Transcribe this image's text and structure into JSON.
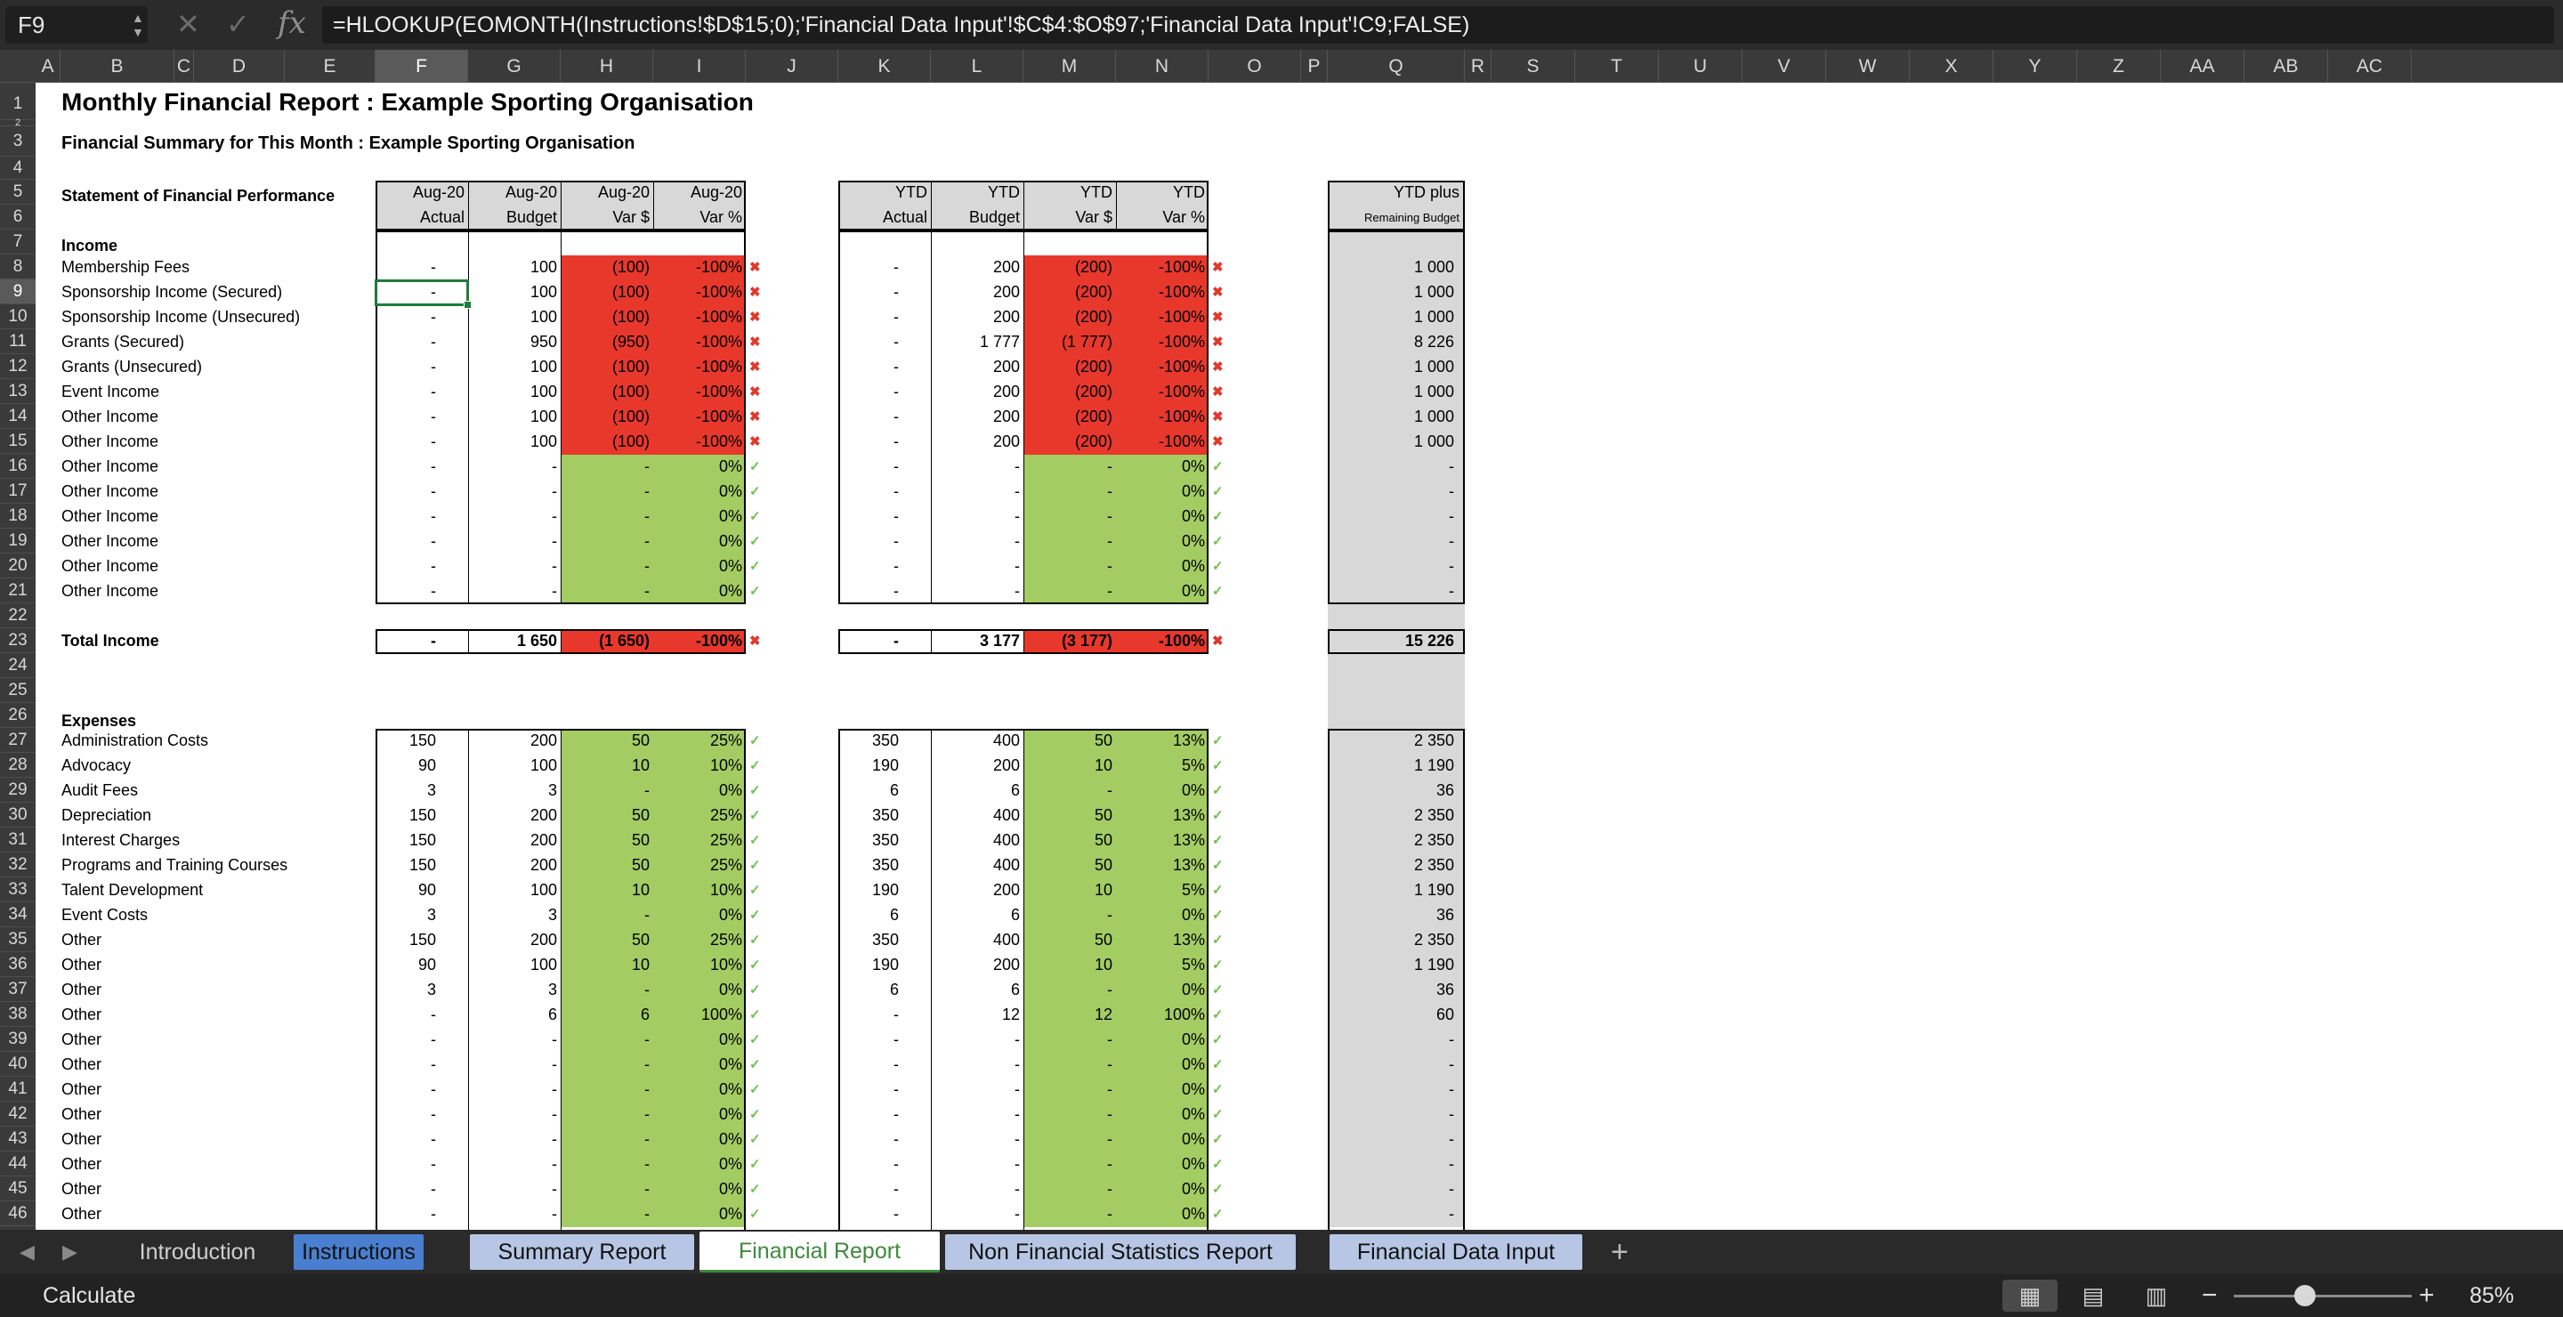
{
  "formula_bar": {
    "cell_ref": "F9",
    "cancel_icon": "✕",
    "confirm_icon": "✓",
    "fx_label": "fx",
    "formula": "=HLOOKUP(EOMONTH(Instructions!$D$15;0);'Financial Data Input'!$C$4:$O$97;'Financial Data Input'!C9;FALSE)"
  },
  "columns": [
    "A",
    "B",
    "C",
    "D",
    "E",
    "F",
    "G",
    "H",
    "I",
    "J",
    "K",
    "L",
    "M",
    "N",
    "O",
    "P",
    "Q",
    "R",
    "S",
    "T",
    "U",
    "V",
    "W",
    "X",
    "Y",
    "Z",
    "AA",
    "AB",
    "AC"
  ],
  "selected_column": "F",
  "selected_row": 9,
  "report": {
    "title": "Monthly Financial Report : Example Sporting Organisation",
    "subtitle": "Financial Summary for This Month : Example Sporting Organisation",
    "statement_label": "Statement of Financial Performance",
    "income_label": "Income",
    "expenses_label": "Expenses"
  },
  "month_headers": {
    "top": [
      "Aug-20",
      "Aug-20",
      "Aug-20",
      "Aug-20"
    ],
    "bottom": [
      "Actual",
      "Budget",
      "Var $",
      "Var %"
    ]
  },
  "ytd_headers": {
    "top": [
      "YTD",
      "YTD",
      "YTD",
      "YTD"
    ],
    "bottom": [
      "Actual",
      "Budget",
      "Var $",
      "Var %"
    ]
  },
  "remaining_header": {
    "top": "YTD plus",
    "bottom": "Remaining Budget"
  },
  "icons": {
    "cross": "✖",
    "check": "✓"
  },
  "status_colors": {
    "unfavourable": "#e8382c",
    "favourable": "#a3cc63",
    "header_fill": "#d8d8d8"
  },
  "income_rows": [
    {
      "row": 8,
      "label": "Membership Fees",
      "m": [
        "-",
        "100",
        "(100)",
        "-100%"
      ],
      "ok": false,
      "y": [
        "-",
        "200",
        "(200)",
        "-100%"
      ],
      "yok": false,
      "rem": "1 000"
    },
    {
      "row": 9,
      "label": "Sponsorship Income (Secured)",
      "m": [
        "-",
        "100",
        "(100)",
        "-100%"
      ],
      "ok": false,
      "y": [
        "-",
        "200",
        "(200)",
        "-100%"
      ],
      "yok": false,
      "rem": "1 000"
    },
    {
      "row": 10,
      "label": "Sponsorship Income (Unsecured)",
      "m": [
        "-",
        "100",
        "(100)",
        "-100%"
      ],
      "ok": false,
      "y": [
        "-",
        "200",
        "(200)",
        "-100%"
      ],
      "yok": false,
      "rem": "1 000"
    },
    {
      "row": 11,
      "label": "Grants (Secured)",
      "m": [
        "-",
        "950",
        "(950)",
        "-100%"
      ],
      "ok": false,
      "y": [
        "-",
        "1 777",
        "(1 777)",
        "-100%"
      ],
      "yok": false,
      "rem": "8 226"
    },
    {
      "row": 12,
      "label": "Grants (Unsecured)",
      "m": [
        "-",
        "100",
        "(100)",
        "-100%"
      ],
      "ok": false,
      "y": [
        "-",
        "200",
        "(200)",
        "-100%"
      ],
      "yok": false,
      "rem": "1 000"
    },
    {
      "row": 13,
      "label": "Event Income",
      "m": [
        "-",
        "100",
        "(100)",
        "-100%"
      ],
      "ok": false,
      "y": [
        "-",
        "200",
        "(200)",
        "-100%"
      ],
      "yok": false,
      "rem": "1 000"
    },
    {
      "row": 14,
      "label": "Other Income",
      "m": [
        "-",
        "100",
        "(100)",
        "-100%"
      ],
      "ok": false,
      "y": [
        "-",
        "200",
        "(200)",
        "-100%"
      ],
      "yok": false,
      "rem": "1 000"
    },
    {
      "row": 15,
      "label": "Other Income",
      "m": [
        "-",
        "100",
        "(100)",
        "-100%"
      ],
      "ok": false,
      "y": [
        "-",
        "200",
        "(200)",
        "-100%"
      ],
      "yok": false,
      "rem": "1 000"
    },
    {
      "row": 16,
      "label": "Other Income",
      "m": [
        "-",
        "-",
        "-",
        "0%"
      ],
      "ok": true,
      "y": [
        "-",
        "-",
        "-",
        "0%"
      ],
      "yok": true,
      "rem": "-"
    },
    {
      "row": 17,
      "label": "Other Income",
      "m": [
        "-",
        "-",
        "-",
        "0%"
      ],
      "ok": true,
      "y": [
        "-",
        "-",
        "-",
        "0%"
      ],
      "yok": true,
      "rem": "-"
    },
    {
      "row": 18,
      "label": "Other Income",
      "m": [
        "-",
        "-",
        "-",
        "0%"
      ],
      "ok": true,
      "y": [
        "-",
        "-",
        "-",
        "0%"
      ],
      "yok": true,
      "rem": "-"
    },
    {
      "row": 19,
      "label": "Other Income",
      "m": [
        "-",
        "-",
        "-",
        "0%"
      ],
      "ok": true,
      "y": [
        "-",
        "-",
        "-",
        "0%"
      ],
      "yok": true,
      "rem": "-"
    },
    {
      "row": 20,
      "label": "Other Income",
      "m": [
        "-",
        "-",
        "-",
        "0%"
      ],
      "ok": true,
      "y": [
        "-",
        "-",
        "-",
        "0%"
      ],
      "yok": true,
      "rem": "-"
    },
    {
      "row": 21,
      "label": "Other Income",
      "m": [
        "-",
        "-",
        "-",
        "0%"
      ],
      "ok": true,
      "y": [
        "-",
        "-",
        "-",
        "0%"
      ],
      "yok": true,
      "rem": "-"
    }
  ],
  "total_income": {
    "row": 23,
    "label": "Total Income",
    "m": [
      "-",
      "1 650",
      "(1 650)",
      "-100%"
    ],
    "ok": false,
    "y": [
      "-",
      "3 177",
      "(3 177)",
      "-100%"
    ],
    "yok": false,
    "rem": "15 226"
  },
  "expense_rows": [
    {
      "row": 27,
      "label": "Administration Costs",
      "m": [
        "150",
        "200",
        "50",
        "25%"
      ],
      "ok": true,
      "y": [
        "350",
        "400",
        "50",
        "13%"
      ],
      "yok": true,
      "rem": "2 350"
    },
    {
      "row": 28,
      "label": "Advocacy",
      "m": [
        "90",
        "100",
        "10",
        "10%"
      ],
      "ok": true,
      "y": [
        "190",
        "200",
        "10",
        "5%"
      ],
      "yok": true,
      "rem": "1 190"
    },
    {
      "row": 29,
      "label": "Audit Fees",
      "m": [
        "3",
        "3",
        "-",
        "0%"
      ],
      "ok": true,
      "y": [
        "6",
        "6",
        "-",
        "0%"
      ],
      "yok": true,
      "rem": "36"
    },
    {
      "row": 30,
      "label": "Depreciation",
      "m": [
        "150",
        "200",
        "50",
        "25%"
      ],
      "ok": true,
      "y": [
        "350",
        "400",
        "50",
        "13%"
      ],
      "yok": true,
      "rem": "2 350"
    },
    {
      "row": 31,
      "label": "Interest Charges",
      "m": [
        "150",
        "200",
        "50",
        "25%"
      ],
      "ok": true,
      "y": [
        "350",
        "400",
        "50",
        "13%"
      ],
      "yok": true,
      "rem": "2 350"
    },
    {
      "row": 32,
      "label": "Programs and Training Courses",
      "m": [
        "150",
        "200",
        "50",
        "25%"
      ],
      "ok": true,
      "y": [
        "350",
        "400",
        "50",
        "13%"
      ],
      "yok": true,
      "rem": "2 350"
    },
    {
      "row": 33,
      "label": "Talent Development",
      "m": [
        "90",
        "100",
        "10",
        "10%"
      ],
      "ok": true,
      "y": [
        "190",
        "200",
        "10",
        "5%"
      ],
      "yok": true,
      "rem": "1 190"
    },
    {
      "row": 34,
      "label": "Event Costs",
      "m": [
        "3",
        "3",
        "-",
        "0%"
      ],
      "ok": true,
      "y": [
        "6",
        "6",
        "-",
        "0%"
      ],
      "yok": true,
      "rem": "36"
    },
    {
      "row": 35,
      "label": "Other",
      "m": [
        "150",
        "200",
        "50",
        "25%"
      ],
      "ok": true,
      "y": [
        "350",
        "400",
        "50",
        "13%"
      ],
      "yok": true,
      "rem": "2 350"
    },
    {
      "row": 36,
      "label": "Other",
      "m": [
        "90",
        "100",
        "10",
        "10%"
      ],
      "ok": true,
      "y": [
        "190",
        "200",
        "10",
        "5%"
      ],
      "yok": true,
      "rem": "1 190"
    },
    {
      "row": 37,
      "label": "Other",
      "m": [
        "3",
        "3",
        "-",
        "0%"
      ],
      "ok": true,
      "y": [
        "6",
        "6",
        "-",
        "0%"
      ],
      "yok": true,
      "rem": "36"
    },
    {
      "row": 38,
      "label": "Other",
      "m": [
        "-",
        "6",
        "6",
        "100%"
      ],
      "ok": true,
      "y": [
        "-",
        "12",
        "12",
        "100%"
      ],
      "yok": true,
      "rem": "60"
    },
    {
      "row": 39,
      "label": "Other",
      "m": [
        "-",
        "-",
        "-",
        "0%"
      ],
      "ok": true,
      "y": [
        "-",
        "-",
        "-",
        "0%"
      ],
      "yok": true,
      "rem": "-"
    },
    {
      "row": 40,
      "label": "Other",
      "m": [
        "-",
        "-",
        "-",
        "0%"
      ],
      "ok": true,
      "y": [
        "-",
        "-",
        "-",
        "0%"
      ],
      "yok": true,
      "rem": "-"
    },
    {
      "row": 41,
      "label": "Other",
      "m": [
        "-",
        "-",
        "-",
        "0%"
      ],
      "ok": true,
      "y": [
        "-",
        "-",
        "-",
        "0%"
      ],
      "yok": true,
      "rem": "-"
    },
    {
      "row": 42,
      "label": "Other",
      "m": [
        "-",
        "-",
        "-",
        "0%"
      ],
      "ok": true,
      "y": [
        "-",
        "-",
        "-",
        "0%"
      ],
      "yok": true,
      "rem": "-"
    },
    {
      "row": 43,
      "label": "Other",
      "m": [
        "-",
        "-",
        "-",
        "0%"
      ],
      "ok": true,
      "y": [
        "-",
        "-",
        "-",
        "0%"
      ],
      "yok": true,
      "rem": "-"
    },
    {
      "row": 44,
      "label": "Other",
      "m": [
        "-",
        "-",
        "-",
        "0%"
      ],
      "ok": true,
      "y": [
        "-",
        "-",
        "-",
        "0%"
      ],
      "yok": true,
      "rem": "-"
    },
    {
      "row": 45,
      "label": "Other",
      "m": [
        "-",
        "-",
        "-",
        "0%"
      ],
      "ok": true,
      "y": [
        "-",
        "-",
        "-",
        "0%"
      ],
      "yok": true,
      "rem": "-"
    },
    {
      "row": 46,
      "label": "Other",
      "m": [
        "-",
        "-",
        "-",
        "0%"
      ],
      "ok": true,
      "y": [
        "-",
        "-",
        "-",
        "0%"
      ],
      "yok": true,
      "rem": "-"
    }
  ],
  "sheet_tabs": [
    {
      "label": "Introduction",
      "style": "plain"
    },
    {
      "label": "Instructions",
      "style": "blue"
    },
    {
      "label": "Summary Report",
      "style": "light"
    },
    {
      "label": "Financial Report",
      "style": "active"
    },
    {
      "label": "Non Financial Statistics Report",
      "style": "light"
    },
    {
      "label": "Financial Data Input",
      "style": "light"
    }
  ],
  "tab_nav": {
    "prev": "◀",
    "next": "▶",
    "add": "+"
  },
  "status_bar": {
    "mode": "Calculate",
    "zoom": "85%",
    "minus": "−",
    "plus": "+",
    "views": [
      "▦",
      "▤",
      "▥"
    ]
  }
}
